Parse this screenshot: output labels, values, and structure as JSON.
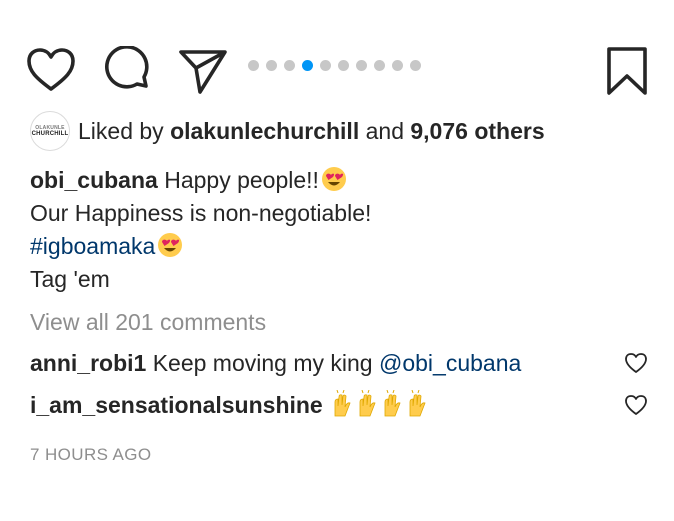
{
  "actions": {
    "like_icon": "heart-outline-icon",
    "comment_icon": "comment-bubble-icon",
    "share_icon": "paper-plane-icon",
    "save_icon": "bookmark-icon",
    "carousel_total": 10,
    "carousel_active": 4,
    "accent_color": "#0095f6"
  },
  "likes": {
    "avatar_label_top": "OLAKUNLE",
    "avatar_label_bottom": "CHURCHILL",
    "prefix": "Liked by",
    "user": "olakunlechurchill",
    "conjunction": "and",
    "others": "9,076 others"
  },
  "caption": {
    "username": "obi_cubana",
    "line1": "Happy people!!",
    "line2": "Our Happiness is non-negotiable!",
    "hashtag": "#igboamaka",
    "line4": "Tag 'em",
    "emoji": "heart-eyes-emoji"
  },
  "view_all": "View all 201 comments",
  "comments": [
    {
      "username": "anni_robi1",
      "text": "Keep moving my king",
      "mention": "@obi_cubana"
    },
    {
      "username": "i_am_sensationalsunshine",
      "text": "",
      "emoji": "raised-hands-emoji"
    }
  ],
  "timestamp": "7 HOURS AGO"
}
